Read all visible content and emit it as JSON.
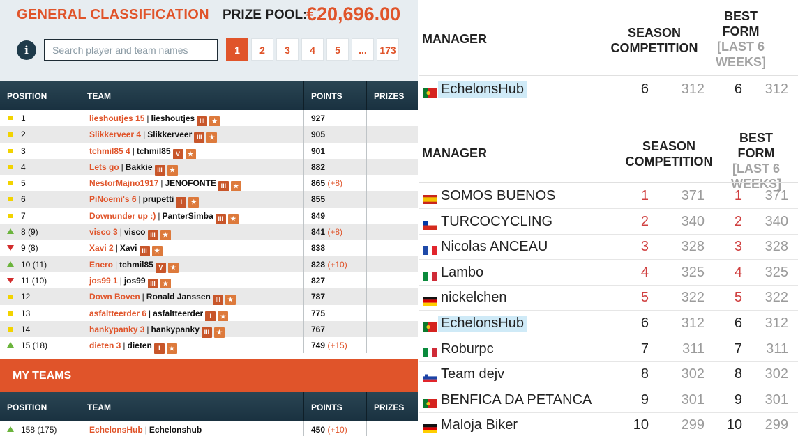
{
  "header": {
    "title": "GENERAL CLASSIFICATION",
    "prize_label": "PRIZE POOL:",
    "prize_value": "€20,696.00",
    "info_label": "i",
    "search_placeholder": "Search player and team names",
    "pages": [
      "1",
      "2",
      "3",
      "4",
      "5",
      "...",
      "173"
    ]
  },
  "columns": {
    "position": "POSITION",
    "team": "TEAM",
    "points": "POINTS",
    "prizes": "PRIZES"
  },
  "rankings": [
    {
      "trend": "same",
      "pos": "1",
      "team": "lieshoutjes 15",
      "manager": "lieshoutjes",
      "b1": "III",
      "b2": "★",
      "points": "927",
      "delta": ""
    },
    {
      "trend": "same",
      "pos": "2",
      "team": "Slikkerveer 4",
      "manager": "Slikkerveer",
      "b1": "III",
      "b2": "★",
      "points": "905",
      "delta": ""
    },
    {
      "trend": "same",
      "pos": "3",
      "team": "tchmil85 4",
      "manager": "tchmil85",
      "b1": "V",
      "b2": "★",
      "points": "901",
      "delta": ""
    },
    {
      "trend": "same",
      "pos": "4",
      "team": "Lets go",
      "manager": "Bakkie",
      "b1": "III",
      "b2": "★",
      "points": "882",
      "delta": ""
    },
    {
      "trend": "same",
      "pos": "5",
      "team": "NestorMajno1917",
      "manager": "JENOFONTE",
      "b1": "III",
      "b2": "★",
      "points": "865",
      "delta": "(+8)"
    },
    {
      "trend": "same",
      "pos": "6",
      "team": "PiNoemi's 6",
      "manager": "prupetti",
      "b1": "I",
      "b2": "★",
      "points": "855",
      "delta": ""
    },
    {
      "trend": "same",
      "pos": "7",
      "team": "Downunder up :)",
      "manager": "PanterSimba",
      "b1": "III",
      "b2": "★",
      "points": "849",
      "delta": ""
    },
    {
      "trend": "up",
      "pos": "8 (9)",
      "team": "visco 3",
      "manager": "visco",
      "b1": "III",
      "b2": "★",
      "points": "841",
      "delta": "(+8)"
    },
    {
      "trend": "down",
      "pos": "9 (8)",
      "team": "Xavi 2",
      "manager": "Xavi",
      "b1": "III",
      "b2": "★",
      "points": "838",
      "delta": ""
    },
    {
      "trend": "up",
      "pos": "10 (11)",
      "team": "Enero",
      "manager": "tchmil85",
      "b1": "V",
      "b2": "★",
      "points": "828",
      "delta": "(+10)"
    },
    {
      "trend": "down",
      "pos": "11 (10)",
      "team": "jos99 1",
      "manager": "jos99",
      "b1": "III",
      "b2": "★",
      "points": "827",
      "delta": ""
    },
    {
      "trend": "same",
      "pos": "12",
      "team": "Down Boven",
      "manager": "Ronald Janssen",
      "b1": "III",
      "b2": "★",
      "points": "787",
      "delta": ""
    },
    {
      "trend": "same",
      "pos": "13",
      "team": "asfaltteerder 6",
      "manager": "asfaltteerder",
      "b1": "I",
      "b2": "★",
      "points": "775",
      "delta": ""
    },
    {
      "trend": "same",
      "pos": "14",
      "team": "hankypanky 3",
      "manager": "hankypanky",
      "b1": "III",
      "b2": "★",
      "points": "767",
      "delta": ""
    },
    {
      "trend": "up",
      "pos": "15 (18)",
      "team": "dieten 3",
      "manager": "dieten",
      "b1": "I",
      "b2": "★",
      "points": "749",
      "delta": "(+15)"
    }
  ],
  "my_teams": {
    "title": "MY TEAMS",
    "rows": [
      {
        "trend": "up",
        "pos": "158 (175)",
        "team": "EchelonsHub",
        "manager": "Echelonshub",
        "points": "450",
        "delta": "(+10)"
      }
    ]
  },
  "right": {
    "manager_head": "MANAGER",
    "season_head_1": "SEASON",
    "season_head_2": "COMPETITION",
    "top": {
      "bf_1": "BEST",
      "bf_2": "FORM",
      "bf_3": "[LAST 6",
      "bf_4": "WEEKS]",
      "row": {
        "flag": "pt",
        "name": "EchelonsHub",
        "r1": "6",
        "p1": "312",
        "r2": "6",
        "p2": "312"
      }
    },
    "bottom": {
      "bf_1": "BEST FORM",
      "bf_2": "[LAST 6",
      "bf_3": "WEEKS]",
      "rows": [
        {
          "flag": "es",
          "name": "SOMOS BUENOS",
          "r1": "1",
          "p1": "371",
          "r2": "1",
          "p2": "371"
        },
        {
          "flag": "cl",
          "name": "TURCOCYCLING",
          "r1": "2",
          "p1": "340",
          "r2": "2",
          "p2": "340"
        },
        {
          "flag": "fr",
          "name": "Nicolas ANCEAU",
          "r1": "3",
          "p1": "328",
          "r2": "3",
          "p2": "328"
        },
        {
          "flag": "it",
          "name": "Lambo",
          "r1": "4",
          "p1": "325",
          "r2": "4",
          "p2": "325"
        },
        {
          "flag": "de",
          "name": "nickelchen",
          "r1": "5",
          "p1": "322",
          "r2": "5",
          "p2": "322"
        },
        {
          "flag": "pt",
          "name": "EchelonsHub",
          "r1": "6",
          "p1": "312",
          "r2": "6",
          "p2": "312"
        },
        {
          "flag": "it",
          "name": "Roburpc",
          "r1": "7",
          "p1": "311",
          "r2": "7",
          "p2": "311"
        },
        {
          "flag": "si",
          "name": "Team dejv",
          "r1": "8",
          "p1": "302",
          "r2": "8",
          "p2": "302"
        },
        {
          "flag": "pt",
          "name": "BENFICA DA PETANCA",
          "r1": "9",
          "p1": "301",
          "r2": "9",
          "p2": "301"
        },
        {
          "flag": "de",
          "name": "Maloja Biker",
          "r1": "10",
          "p1": "299",
          "r2": "10",
          "p2": "299"
        }
      ]
    }
  }
}
